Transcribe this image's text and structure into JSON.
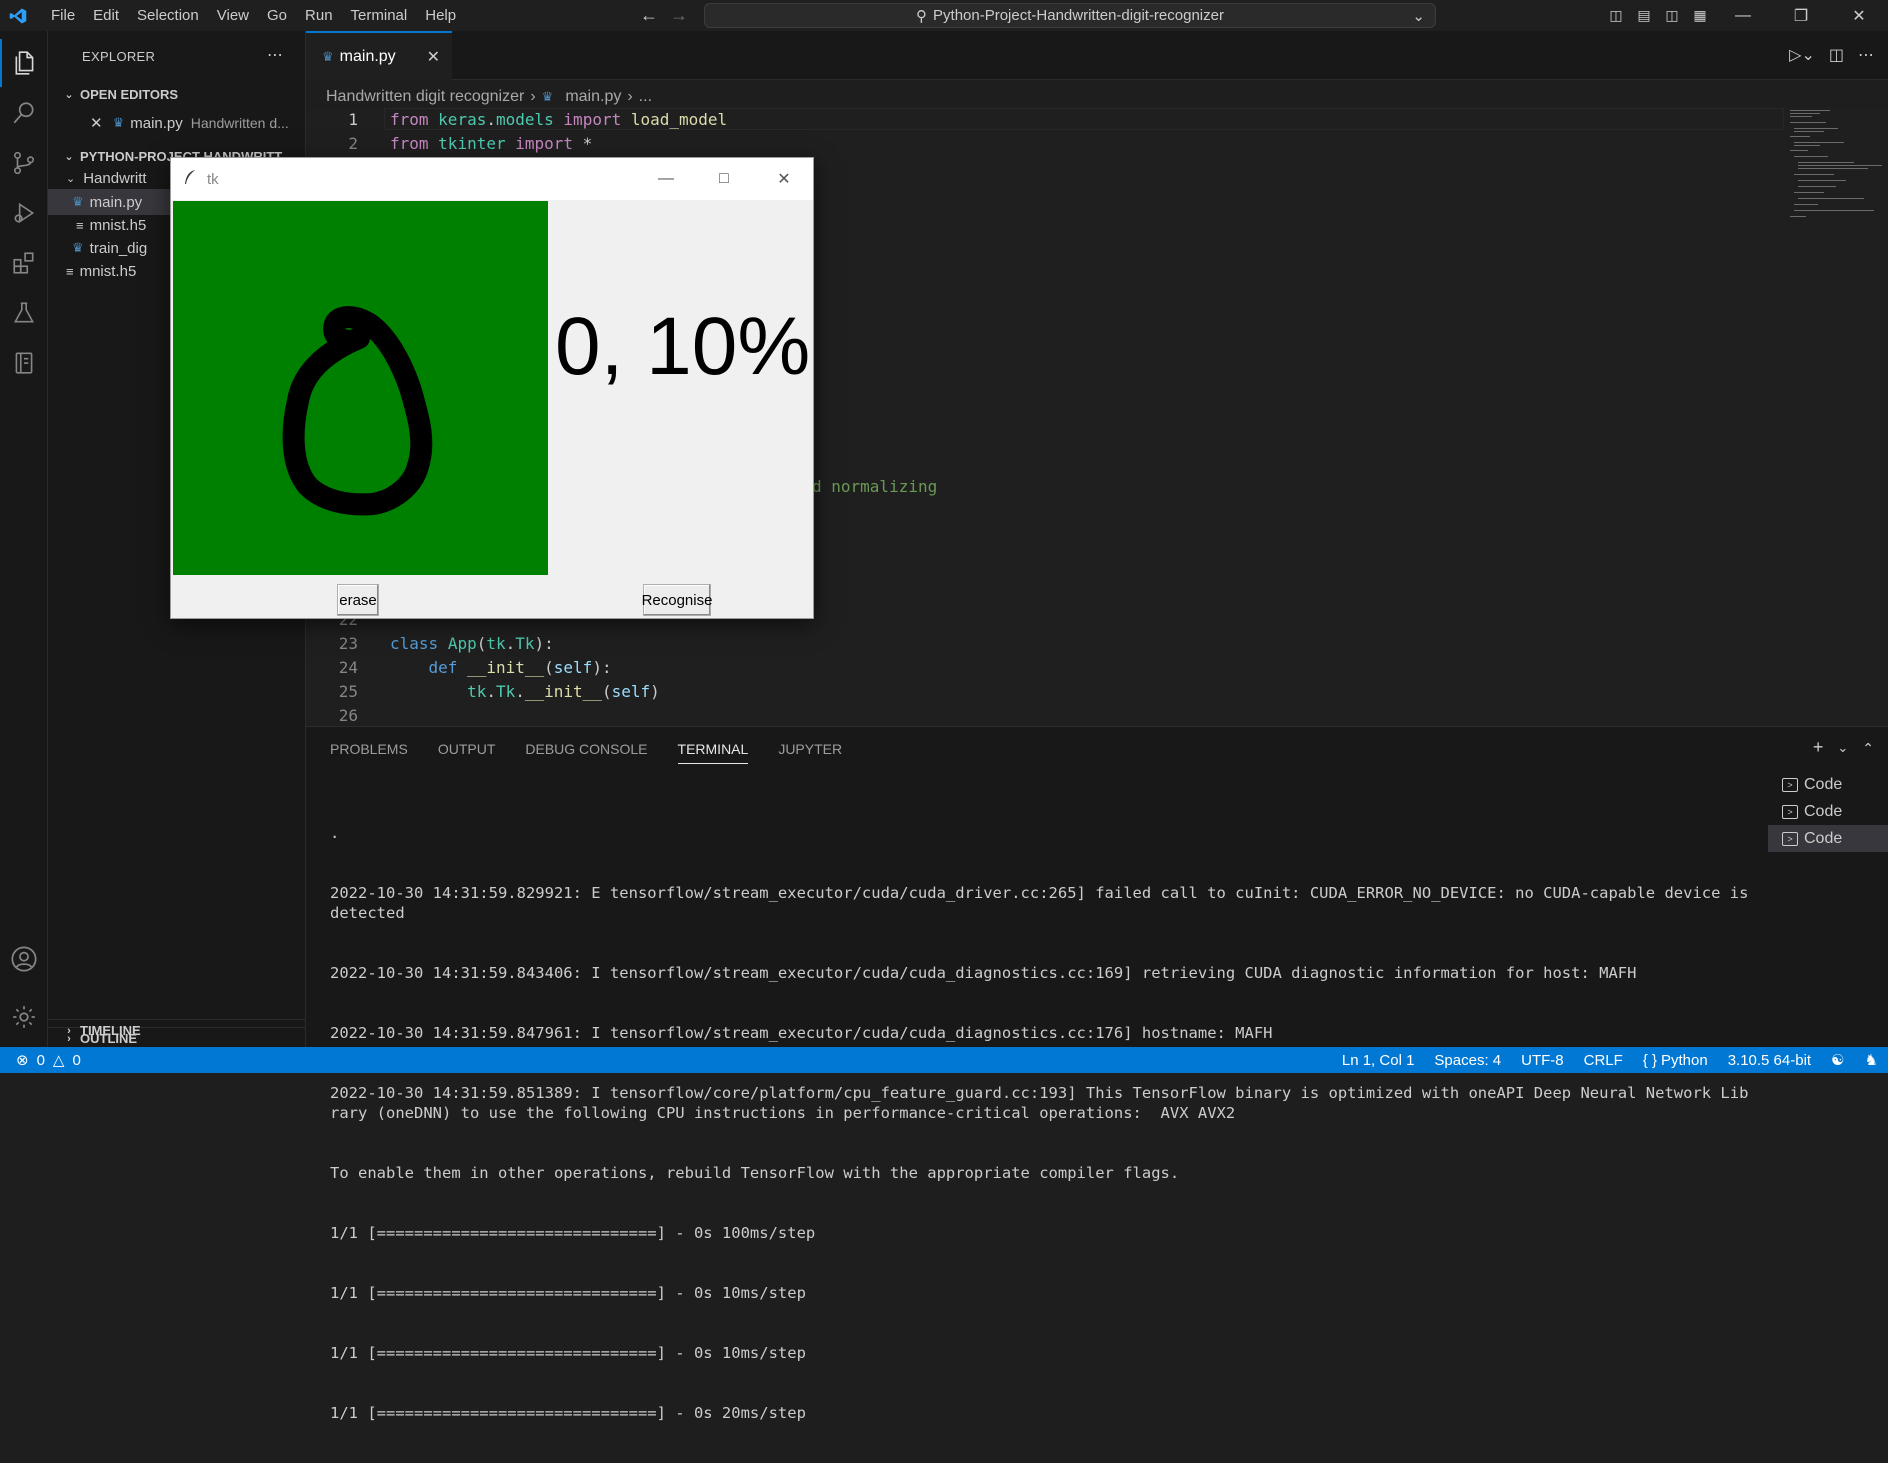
{
  "menubar": [
    "File",
    "Edit",
    "Selection",
    "View",
    "Go",
    "Run",
    "Terminal",
    "Help"
  ],
  "command_center": "Python-Project-Handwritten-digit-recognizer",
  "explorer": {
    "header": "EXPLORER",
    "open_editors_label": "OPEN EDITORS",
    "open_editor_file": "main.py",
    "open_editor_path": "Handwritten d...",
    "project_label": "PYTHON-PROJECT-HANDWRITT...",
    "folder": "Handwritt",
    "files": [
      "main.py",
      "mnist.h5",
      "train_dig"
    ],
    "root_file": "mnist.h5",
    "outline_label": "OUTLINE",
    "timeline_label": "TIMELINE"
  },
  "tab": {
    "name": "main.py"
  },
  "breadcrumb": {
    "folder": "Handwritten digit recognizer",
    "file": "main.py",
    "more": "..."
  },
  "code": {
    "line_numbers_top": [
      "1",
      "2"
    ],
    "line_numbers_bottom": [
      "22",
      "23",
      "24",
      "25",
      "26"
    ],
    "partial_comment": "d normalizing"
  },
  "panel": {
    "tabs": [
      "PROBLEMS",
      "OUTPUT",
      "DEBUG CONSOLE",
      "TERMINAL",
      "JUPYTER"
    ],
    "active_tab": "TERMINAL",
    "terminal_lines": [
      ".",
      "2022-10-30 14:31:59.829921: E tensorflow/stream_executor/cuda/cuda_driver.cc:265] failed call to cuInit: CUDA_ERROR_NO_DEVICE: no CUDA-capable device is detected",
      "2022-10-30 14:31:59.843406: I tensorflow/stream_executor/cuda/cuda_diagnostics.cc:169] retrieving CUDA diagnostic information for host: MAFH",
      "2022-10-30 14:31:59.847961: I tensorflow/stream_executor/cuda/cuda_diagnostics.cc:176] hostname: MAFH",
      "2022-10-30 14:31:59.851389: I tensorflow/core/platform/cpu_feature_guard.cc:193] This TensorFlow binary is optimized with oneAPI Deep Neural Network Library (oneDNN) to use the following CPU instructions in performance-critical operations:  AVX AVX2",
      "To enable them in other operations, rebuild TensorFlow with the appropriate compiler flags.",
      "1/1 [==============================] - 0s 100ms/step",
      "1/1 [==============================] - 0s 10ms/step",
      "1/1 [==============================] - 0s 10ms/step",
      "1/1 [==============================] - 0s 20ms/step"
    ],
    "terminals": [
      "Code",
      "Code",
      "Code"
    ]
  },
  "statusbar": {
    "errors": "0",
    "warnings": "0",
    "position": "Ln 1, Col 1",
    "spaces": "Spaces: 4",
    "encoding": "UTF-8",
    "eol": "CRLF",
    "language": "Python",
    "interpreter": "3.10.5 64-bit"
  },
  "tk_window": {
    "title": "tk",
    "result": "0, 10%",
    "erase_label": "erase",
    "recognise_label": "Recognise",
    "canvas_color": "#008000"
  },
  "colors": {
    "accent": "#0078d4",
    "statusbar": "#0078d4"
  }
}
